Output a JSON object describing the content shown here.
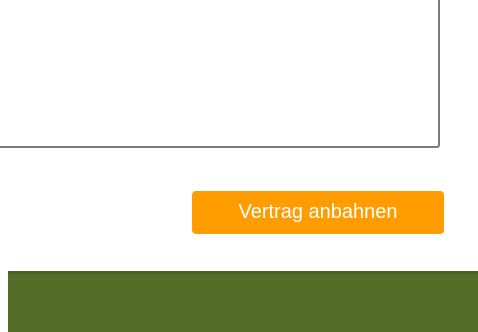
{
  "form": {
    "message_value": "",
    "submit_label": "Vertrag anbahnen"
  },
  "colors": {
    "button_background": "#ff9d00",
    "button_text": "#ffffff",
    "footer_background": "#536c28",
    "textarea_border": "#7a7a7a"
  }
}
